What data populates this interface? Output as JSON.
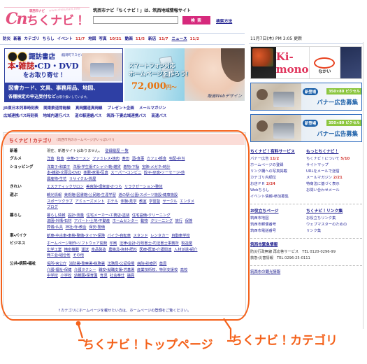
{
  "header": {
    "logo_cn": "Cn",
    "logo_main": "ちくナビ！",
    "logo_sub": "筑西市ナビ",
    "logo_url": "www.chikunavi.info",
    "tagline": "筑西市ナビ「ちくナビ！」は、筑西地域情報サイト",
    "search_value": "",
    "search_placeholder": "",
    "search_button": "検 索",
    "search_help": "検索方法",
    "updated": "11月7日(木) PM 3:05 更新"
  },
  "nav": [
    {
      "label": "防災",
      "date": "",
      "underline": false
    },
    {
      "label": "新着",
      "date": "",
      "underline": false
    },
    {
      "label": "カテゴリ",
      "date": "",
      "underline": false
    },
    {
      "label": "ちらし",
      "date": "",
      "underline": false
    },
    {
      "label": "イベント",
      "date": "11/7",
      "underline": false
    },
    {
      "label": "地図",
      "date": "",
      "underline": false
    },
    {
      "label": "写真",
      "date": "10/21",
      "underline": false
    },
    {
      "label": "動画",
      "date": "11/5",
      "underline": false
    },
    {
      "label": "新店",
      "date": "11/7",
      "underline": false
    },
    {
      "label": "ニュース",
      "date": "11/2",
      "underline": true
    }
  ],
  "banner_book": {
    "shop": "諏訪書店",
    "shop_note": "(稲荷町マスゼン)",
    "line2_parts": [
      "本",
      "雑誌",
      "CD",
      "DVD"
    ],
    "line3": "をお取り寄せ！",
    "blue1": "図書カード、文具、事務用品、地図、",
    "blue2": "各種検定の申込受付など",
    "blue2_small": "お取り扱いしています。"
  },
  "banner_web": {
    "line1": "スマートフォン対応",
    "line2": "ホームページを作ろう!",
    "price": "72,000",
    "price_unit": "円～",
    "brand": "飯島Webデザイン"
  },
  "quicklinks": [
    [
      "JR東日本列車時刻表",
      "関東鉄道常総線",
      "真岡鐵道真岡線",
      "プレゼント企画",
      "メールマガジン"
    ],
    [
      "広域連携バス時刻表",
      "地域内運行バス",
      "道の駅連絡バス",
      "筑西・下妻広域連携バス",
      "高速バス"
    ]
  ],
  "category": {
    "title": "ちくナビ！カテゴリ",
    "subtitle": "(筑西市内のホームページがいっぱい!!!)",
    "note": "↑カテゴリにホームページを載せたい方は、ホームページの登録をご覧ください。",
    "rows": [
      {
        "label": "新着",
        "plain": "現在、新着サイトはありません。",
        "lines": [
          [
            "登録履歴 一覧"
          ]
        ]
      },
      {
        "label": "グルメ",
        "lines": [
          [
            "洋食",
            "和食",
            "中華・ラーメン",
            "ファミレス・焼肉",
            "寿司",
            "酒・食事",
            "カフェ・軽食",
            "宅配・弁当"
          ]
        ]
      },
      {
        "label": "ショッピング",
        "lines": [
          [
            "洋菓子・和菓子",
            "洋服・学生服・Tシャツ・靴・雑貨",
            "着物・下駄",
            "宝飾・メガネ・時計"
          ],
          [
            "本・雑誌・文房具・DVD",
            "楽器・家電・写真",
            "スーパー・コンビニ",
            "餃子・豆腐・ソーセージ・他"
          ],
          [
            "農産物・生花",
            "リサイクル・質屋"
          ]
        ]
      },
      {
        "label": "きれい",
        "lines": [
          [
            "エステティックサロン",
            "美容院・理容室・かつら",
            "リラクゼーション・整体"
          ]
        ]
      },
      {
        "label": "遊ぶ",
        "lines": [
          [
            "観光情報",
            "美術館・図書館・公民館・生涯学習",
            "道の駅・公園・スポーツ施設・健康施設"
          ],
          [
            "スポーツクラブ",
            "アミューズメント",
            "ホテル",
            "体験・見学",
            "教室",
            "学習塾",
            "サークル",
            "エンタメ"
          ],
          [
            "ブログ"
          ]
        ]
      },
      {
        "label": "暮らし",
        "lines": [
          [
            "暮らし情報",
            "設計・測量",
            "住宅メーカー・工務店・塗装",
            "住宅設備・クリーニング"
          ],
          [
            "造園・外構・石材",
            "アパート・土地・不動産",
            "ホームセンター",
            "動物",
            "クリーニング",
            "旅行",
            "保険"
          ],
          [
            "葬儀・仏具",
            "神社・寺・教会",
            "保安・警備"
          ]
        ]
      },
      {
        "label": "車・バイク",
        "lines": [
          [
            "新車・中古車・車検・整備・タイヤ・保険",
            "バイク・自転車",
            "スタンド",
            "レンタカー",
            "自動車学校"
          ]
        ]
      },
      {
        "label": "ビジネス",
        "lines": [
          [
            "ホームページ制作・ソフトウェア開発",
            "印刷",
            "法律・会計・行政書士・司法書士事務所",
            "製造業"
          ],
          [
            "化学工業",
            "精密機器",
            "運送",
            "食品製造",
            "農機具・資材・肥料",
            "医療・医薬・介護関連",
            "人材派遣・紹介"
          ],
          [
            "商工会・組合他",
            "その他"
          ]
        ]
      },
      {
        "label": "公共・病院・福祉",
        "lines": [
          [
            "役所・官公庁",
            "消防署・警察署・税務署",
            "法務局・公証役場",
            "病院・診療所",
            "薬局"
          ],
          [
            "介護・福祉・保健",
            "介護タクシー",
            "職安・就職支援・労基署",
            "産業技術校、特別支援校",
            "高校"
          ],
          [
            "中学校",
            "小学校",
            "幼稚園・保育園",
            "育児",
            "社会奉仕",
            "議員"
          ]
        ]
      }
    ]
  },
  "sidebar": {
    "kimono_banner": {
      "brand": "Ki-mono",
      "shop": "なかい",
      "note": "きもの専門店"
    },
    "ad_banners": [
      {
        "new_tag": "新登場",
        "size_tag": "350×80 ピクセル",
        "label": "バナー広告募集"
      },
      {
        "new_tag": "新登場",
        "size_tag": "350×80 ピクセル",
        "label": "バナー広告募集"
      }
    ],
    "paid_services": {
      "title": "ちくナビ！有料サービス",
      "items": [
        {
          "label": "バナー広告",
          "date": "11/2"
        },
        {
          "label": "ホームページの登録",
          "date": ""
        },
        {
          "label": "リンク欄への写真掲載",
          "date": ""
        },
        {
          "label": "カテゴリ内順位",
          "date": ""
        },
        {
          "label": "お店ＰＲ",
          "date": "2/24"
        },
        {
          "label": "Webちらし",
          "date": ""
        },
        {
          "label": "イベント情報・参加募集",
          "date": ""
        }
      ]
    },
    "more": {
      "title": "もっとちくナビ！",
      "items": [
        {
          "label": "ちくナビ！について",
          "date": "5/10"
        },
        {
          "label": "サイトマップ",
          "date": ""
        },
        {
          "label": "URLをメールで送信",
          "date": ""
        },
        {
          "label": "メールマガジン",
          "date": "2/21"
        },
        {
          "label": "特商法に基づく表示",
          "date": ""
        },
        {
          "label": "お問い合わせメール",
          "date": ""
        }
      ]
    },
    "useful": {
      "title": "お役立ちページ",
      "items": [
        {
          "label": "筑西市地図",
          "date": ""
        },
        {
          "label": "筑西市郵便番号",
          "date": ""
        },
        {
          "label": "筑西市電話番号",
          "date": ""
        }
      ]
    },
    "links": {
      "title": "ちくナビ！リンク集",
      "items": [
        {
          "label": "お役立ちリンク集",
          "date": ""
        },
        {
          "label": "ウェブマスターのための",
          "date": ""
        },
        {
          "label": "リンク集",
          "date": ""
        }
      ]
    },
    "emergency": {
      "title": "筑西市緊急情報",
      "lines": [
        "防災行政無線 再応答サービス　TEL 0120-0296-99",
        "救急・災害情報　TEL 0296-25-0111"
      ]
    },
    "tourism": "筑西市の観光情報"
  },
  "annotations": {
    "left": "ちくナビ！トップページ",
    "right": "ちくナビ！カテゴリ",
    "color": "#f4611a"
  }
}
